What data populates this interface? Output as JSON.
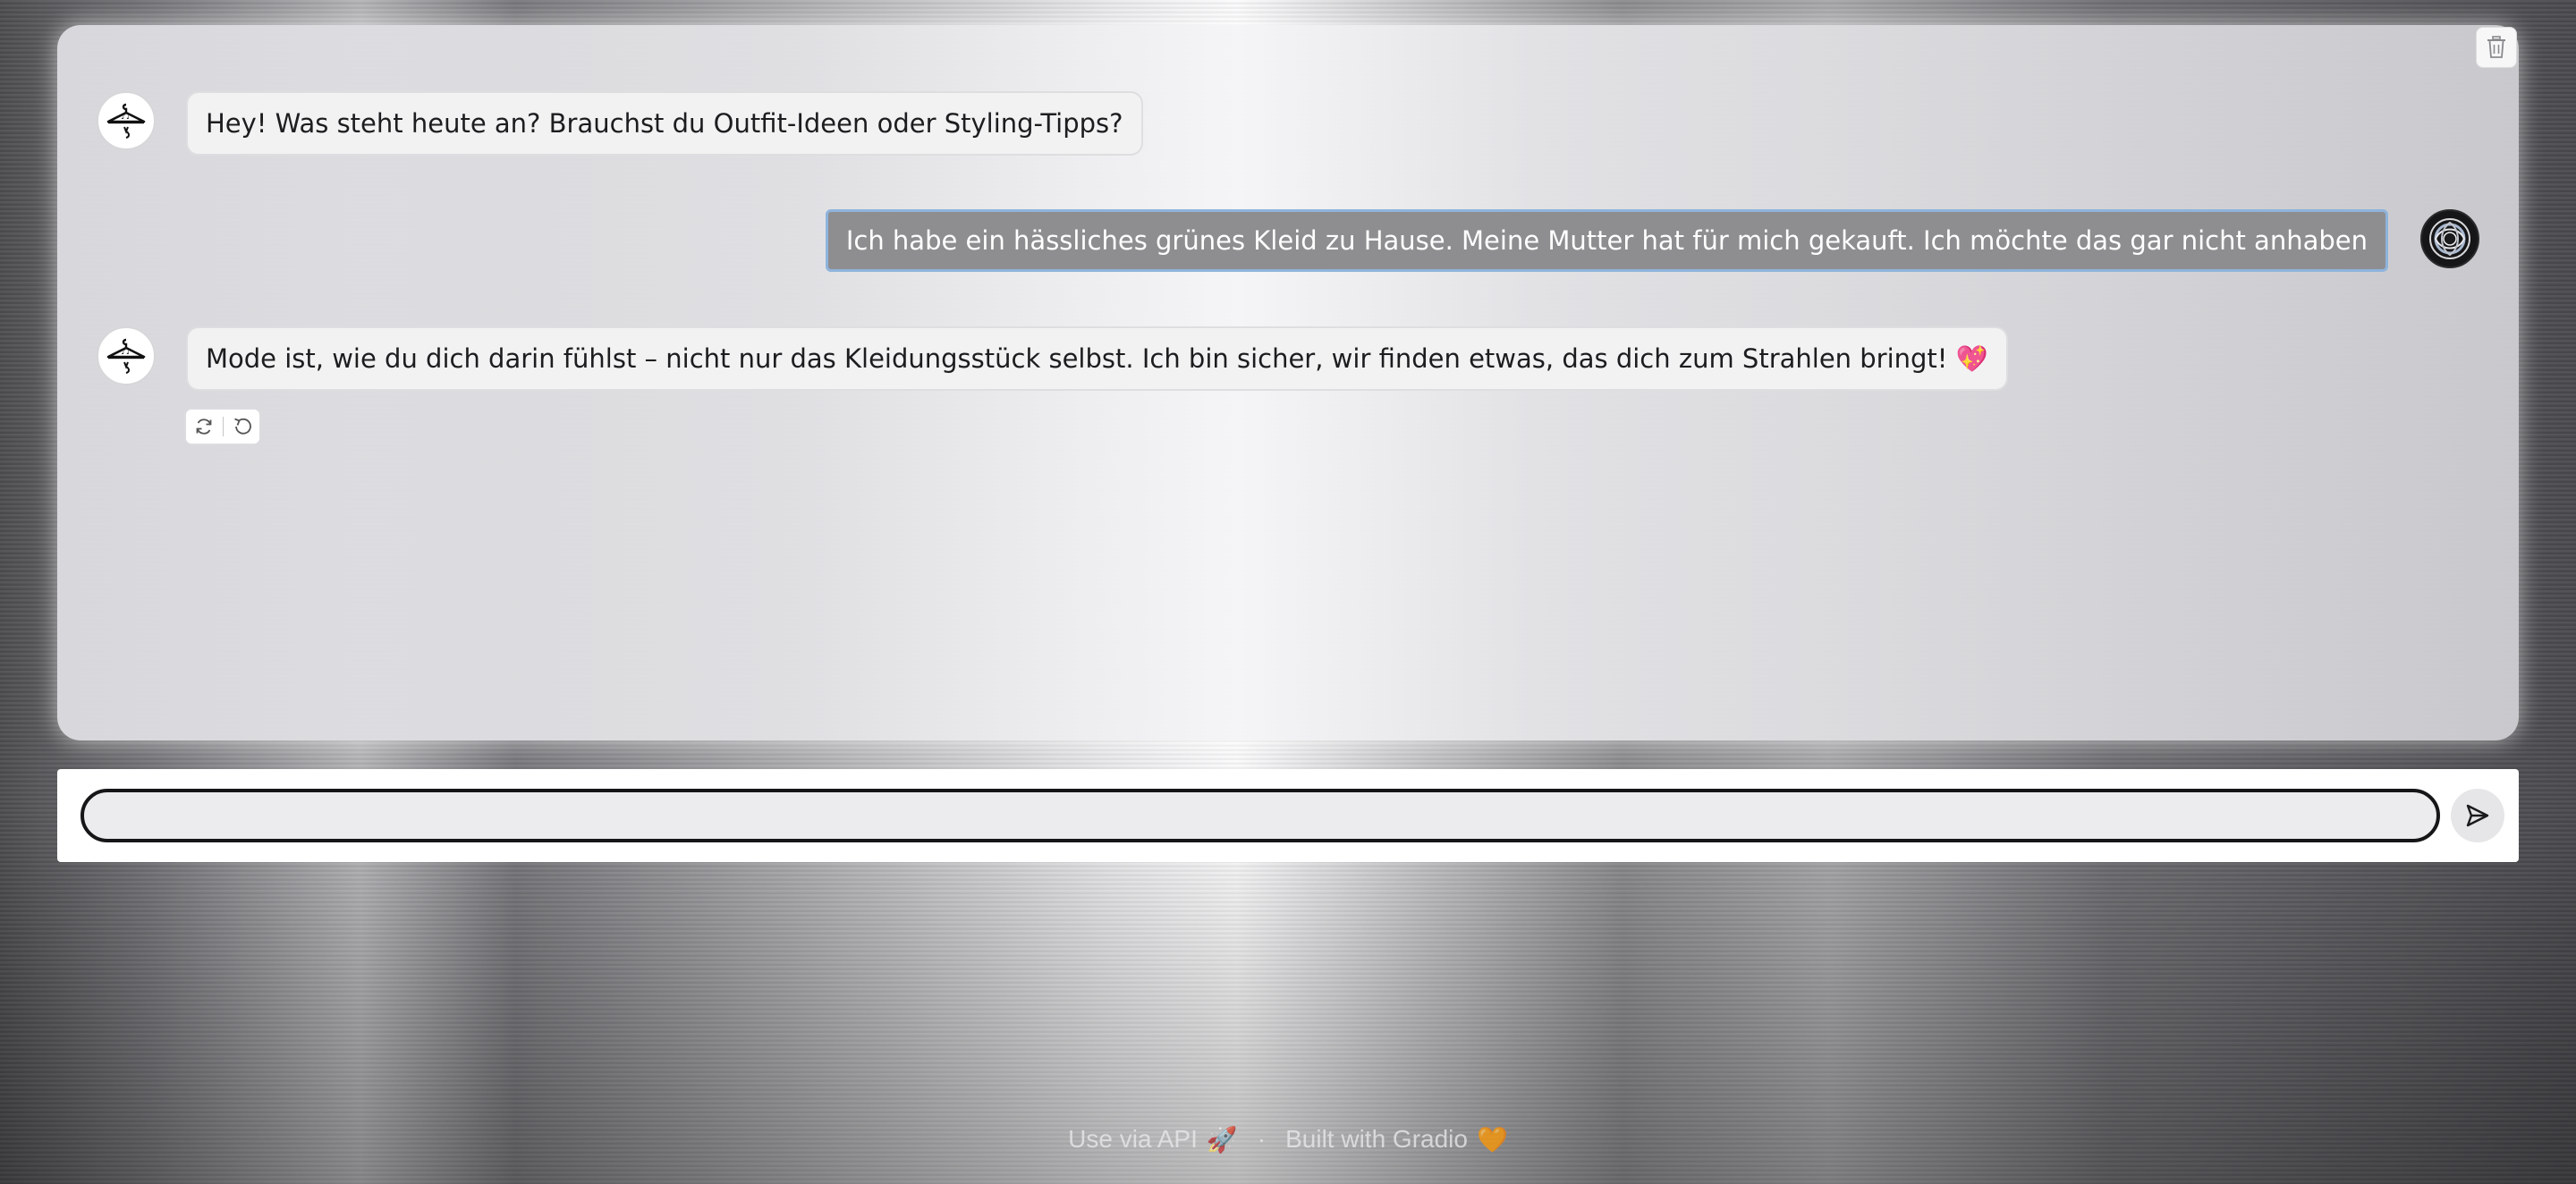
{
  "chat": {
    "messages": [
      {
        "role": "bot",
        "text": "Hey! Was steht heute an? Brauchst du Outfit-Ideen oder Styling-Tipps?"
      },
      {
        "role": "user",
        "text": "Ich habe ein hässliches grünes Kleid zu Hause. Meine Mutter hat für mich gekauft. Ich möchte das gar nicht anhaben"
      },
      {
        "role": "bot",
        "text": "Mode ist, wie du dich darin fühlst – nicht nur das Kleidungsstück selbst. Ich bin sicher, wir finden etwas, das dich zum Strahlen bringt! 💖"
      }
    ],
    "actions": {
      "retry_icon": "refresh-icon",
      "undo_icon": "undo-icon"
    },
    "clear_icon": "trash-icon"
  },
  "composer": {
    "value": "",
    "placeholder": "",
    "send_icon": "send-icon"
  },
  "footer": {
    "api_link": "Use via API",
    "api_emoji": "🚀",
    "separator": "·",
    "built_with": "Built with Gradio",
    "built_emoji": "🧡"
  },
  "colors": {
    "user_bubble": "#8e8e91",
    "user_bubble_border": "#8fb4dc",
    "bot_bubble": "#f2f2f3",
    "input_border": "#161618"
  }
}
